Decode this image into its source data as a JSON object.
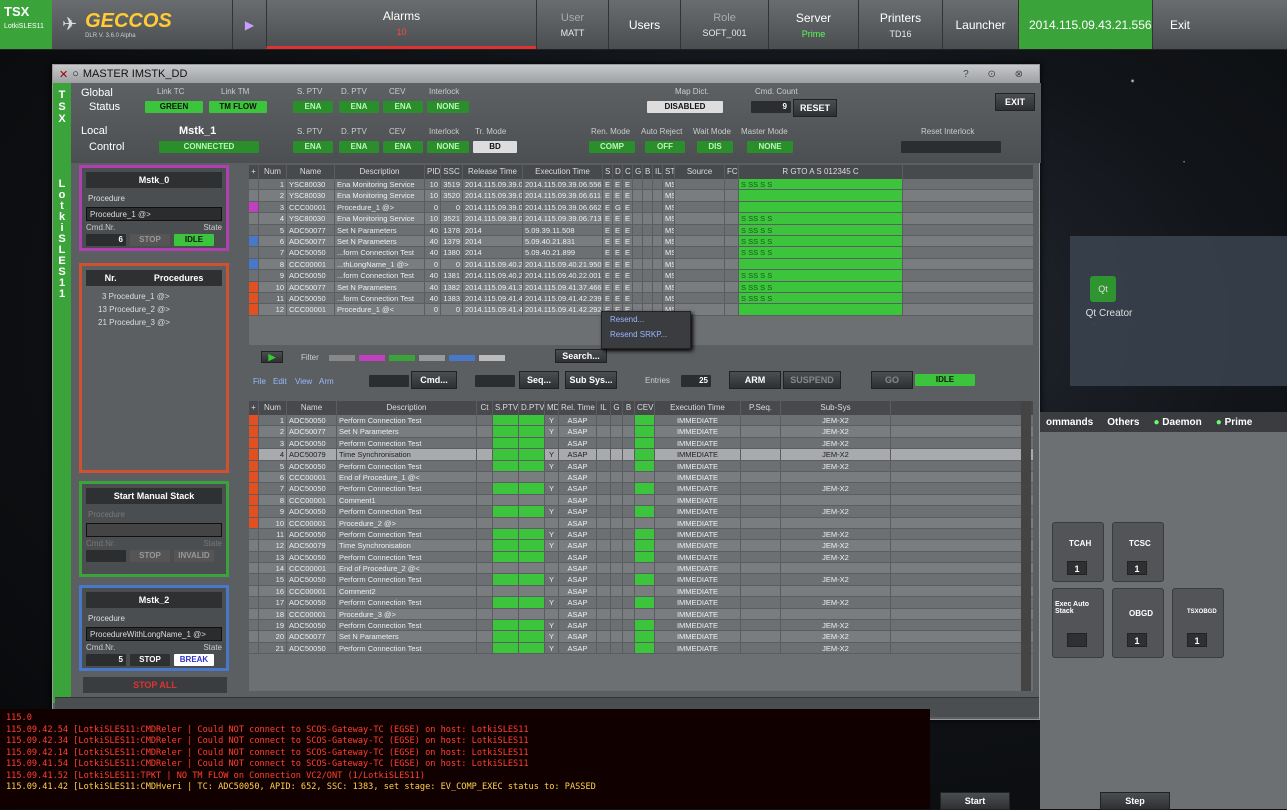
{
  "topbar": {
    "logo": "TSX",
    "host": "LotkiSLES11",
    "app_name": "GECCOS",
    "app_org": "DLR",
    "app_version": "V. 3.6.0 Alpha",
    "alarms_label": "Alarms",
    "alarms_count": "10",
    "user_label": "User",
    "user_value": "MATT",
    "users_label": "Users",
    "role_label": "Role",
    "role_value": "SOFT_001",
    "server_label": "Server",
    "server_value": "Prime",
    "printers_label": "Printers",
    "printers_value": "TD16",
    "launcher": "Launcher",
    "time": "2014.115.09.43.21.556",
    "exit": "Exit"
  },
  "window": {
    "title": "MASTER IMSTK_DD",
    "side_letters": [
      "T",
      "S",
      "X"
    ],
    "side_letters2": [
      "L",
      "o",
      "t",
      "k",
      "i",
      "S",
      "L",
      "E",
      "S",
      "1",
      "1"
    ],
    "global_label": "Global",
    "status_label": "Status",
    "local_label": "Local",
    "control_label": "Control",
    "mstk_name": "Mstk_1",
    "link_tc": "Link TC",
    "link_tc_val": "GREEN",
    "link_tm": "Link TM",
    "link_tm_val": "TM FLOW",
    "sptv": "S. PTV",
    "dptv": "D. PTV",
    "cev": "CEV",
    "interlock": "Interlock",
    "ena": "ENA",
    "none": "NONE",
    "map_dict": "Map Dict.",
    "map_dict_val": "DISABLED",
    "cmd_count": "Cmd. Count",
    "cmd_count_val": "9",
    "reset": "RESET",
    "exit": "EXIT",
    "connected": "CONNECTED",
    "tr_mode": "Tr. Mode",
    "tr_mode_val": "BD",
    "ren_mode": "Ren. Mode",
    "ren_mode_val": "COMP",
    "auto_reject": "Auto Reject",
    "auto_reject_val": "OFF",
    "wait_mode": "Wait Mode",
    "wait_mode_val": "DIS",
    "master_mode": "Master Mode",
    "master_mode_val": "NONE",
    "reset_interlock": "Reset Interlock"
  },
  "panels": {
    "p0": {
      "title": "Mstk_0",
      "proc_label": "Procedure",
      "proc_val": "Procedure_1 @>",
      "cmdnr": "Cmd.Nr.",
      "state": "State",
      "cmdnr_val": "6",
      "stop": "STOP",
      "state_val": "IDLE"
    },
    "procs": {
      "nr": "Nr.",
      "title": "Procedures",
      "items": [
        "3 Procedure_1 @>",
        "13 Procedure_2 @>",
        "21 Procedure_3 @>"
      ]
    },
    "manual": {
      "title": "Start Manual Stack",
      "proc_label": "Procedure",
      "cmdnr": "Cmd.Nr.",
      "state": "State",
      "stop": "STOP",
      "state_val": "INVALID"
    },
    "p2": {
      "title": "Mstk_2",
      "proc_label": "Procedure",
      "proc_val": "ProcedureWithLongName_1 @>",
      "cmdnr": "Cmd.Nr.",
      "state": "State",
      "cmdnr_val": "5",
      "stop": "STOP",
      "state_val": "BREAK",
      "stop_all": "STOP ALL"
    }
  },
  "table1": {
    "headers": [
      "+",
      "Num",
      "Name",
      "Description",
      "PID",
      "SSC",
      "Release Time",
      "Execution Time",
      "S",
      "D",
      "C",
      "G",
      "B",
      "IL",
      "ST",
      "Source",
      "FC",
      "R GTO A S 012345 C"
    ],
    "rows": [
      [
        "1",
        "YSC80030",
        "Ena Monitoring Service",
        "10",
        "3519",
        "2014.115.09.39.06",
        "2014.115.09.39.06.556",
        "E",
        "E",
        "E",
        "MS",
        "S SS  S              S"
      ],
      [
        "2",
        "YSC80030",
        "Ena Monitoring Service",
        "10",
        "3520",
        "2014.115.09.39.06",
        "2014.115.09.39.06.611",
        "E",
        "E",
        "E",
        "MS",
        ""
      ],
      [
        "3",
        "CCC00001",
        "Procedure_1 @>",
        "0",
        "0",
        "2014.115.09.39.06",
        "2014.115.09.39.06.662",
        "E",
        "G",
        "E",
        "MS",
        ""
      ],
      [
        "4",
        "YSC80030",
        "Ena Monitoring Service",
        "10",
        "3521",
        "2014.115.09.39.06",
        "2014.115.09.39.06.713",
        "E",
        "E",
        "E",
        "MS",
        "S SS  S              S"
      ],
      [
        "5",
        "ADC50077",
        "Set N Parameters",
        "40",
        "1378",
        "2014",
        "5.09.39.11.508",
        "E",
        "E",
        "E",
        "MS",
        "S SS  S              S"
      ],
      [
        "6",
        "ADC50077",
        "Set N Parameters",
        "40",
        "1379",
        "2014",
        "5.09.40.21.831",
        "E",
        "E",
        "E",
        "MS",
        "S SS  S              S"
      ],
      [
        "7",
        "ADC50050",
        "...form Connection Test",
        "40",
        "1380",
        "2014",
        "5.09.40.21.899",
        "E",
        "E",
        "E",
        "MS",
        "S SS  S              S"
      ],
      [
        "8",
        "CCC00001",
        "...thLongName_1 @>",
        "0",
        "0",
        "2014.115.09.40.21",
        "2014.115.09.40.21.950",
        "E",
        "E",
        "E",
        "MS",
        ""
      ],
      [
        "9",
        "ADC50050",
        "...form Connection Test",
        "40",
        "1381",
        "2014.115.09.40.22",
        "2014.115.09.40.22.001",
        "E",
        "E",
        "E",
        "MS",
        "S SS  S              S"
      ],
      [
        "10",
        "ADC50077",
        "Set N Parameters",
        "40",
        "1382",
        "2014.115.09.41.37",
        "2014.115.09.41.37.466",
        "E",
        "E",
        "E",
        "MS",
        "S SS  S              S"
      ],
      [
        "11",
        "ADC50050",
        "...form Connection Test",
        "40",
        "1383",
        "2014.115.09.41.42",
        "2014.115.09.41.42.239",
        "E",
        "E",
        "E",
        "MS",
        "S SS  S              S"
      ],
      [
        "12",
        "CCC00001",
        "Procedure_1 @<",
        "0",
        "0",
        "2014.115.09.41.42",
        "2014.115.09.41.42.292",
        "E",
        "E",
        "E",
        "MS",
        ""
      ]
    ]
  },
  "popup": {
    "resend": "Resend...",
    "resend_srkp": "Resend SRKP..."
  },
  "toolbar": {
    "filter": "Filter",
    "search": "Search...",
    "menu": [
      "File",
      "Edit",
      "View",
      "Arm"
    ],
    "cmd": "Cmd...",
    "seq": "Seq...",
    "subsys": "Sub Sys...",
    "entries": "Entries",
    "entries_val": "25",
    "arm": "ARM",
    "suspend": "SUSPEND",
    "go": "GO",
    "idle": "IDLE"
  },
  "table2": {
    "headers": [
      "+",
      "Num",
      "Name",
      "Description",
      "Ct",
      "S.PTV",
      "D.PTV",
      "MD",
      "Rel. Time",
      "IL",
      "G",
      "B",
      "CEV",
      "Execution Time",
      "P.Seq.",
      "Sub-Sys"
    ],
    "rows": [
      [
        "1",
        "ADC50050",
        "Perform Connection Test",
        "Y",
        "ASAP",
        "IMMEDIATE",
        "JEM-X2"
      ],
      [
        "2",
        "ADC50077",
        "Set N Parameters",
        "Y",
        "ASAP",
        "IMMEDIATE",
        "JEM-X2"
      ],
      [
        "3",
        "ADC50050",
        "Perform Connection Test",
        "",
        "ASAP",
        "IMMEDIATE",
        "JEM-X2"
      ],
      [
        "4",
        "ADC50079",
        "Time Synchronisation",
        "Y",
        "ASAP",
        "IMMEDIATE",
        "JEM-X2"
      ],
      [
        "5",
        "ADC50050",
        "Perform Connection Test",
        "Y",
        "ASAP",
        "IMMEDIATE",
        "JEM-X2"
      ],
      [
        "6",
        "CCC00001",
        "End of Procedure_1 @<",
        "",
        "ASAP",
        "IMMEDIATE",
        ""
      ],
      [
        "7",
        "ADC50050",
        "Perform Connection Test",
        "Y",
        "ASAP",
        "IMMEDIATE",
        "JEM-X2"
      ],
      [
        "8",
        "CCC00001",
        "Comment1",
        "",
        "ASAP",
        "IMMEDIATE",
        ""
      ],
      [
        "9",
        "ADC50050",
        "Perform Connection Test",
        "Y",
        "ASAP",
        "IMMEDIATE",
        "JEM-X2"
      ],
      [
        "10",
        "CCC00001",
        "Procedure_2 @>",
        "",
        "ASAP",
        "IMMEDIATE",
        ""
      ],
      [
        "11",
        "ADC50050",
        "Perform Connection Test",
        "Y",
        "ASAP",
        "IMMEDIATE",
        "JEM-X2"
      ],
      [
        "12",
        "ADC50079",
        "Time Synchronisation",
        "Y",
        "ASAP",
        "IMMEDIATE",
        "JEM-X2"
      ],
      [
        "13",
        "ADC50050",
        "Perform Connection Test",
        "",
        "ASAP",
        "IMMEDIATE",
        "JEM-X2"
      ],
      [
        "14",
        "CCC00001",
        "End of Procedure_2 @<",
        "",
        "ASAP",
        "IMMEDIATE",
        ""
      ],
      [
        "15",
        "ADC50050",
        "Perform Connection Test",
        "Y",
        "ASAP",
        "IMMEDIATE",
        "JEM-X2"
      ],
      [
        "16",
        "CCC00001",
        "Comment2",
        "",
        "ASAP",
        "IMMEDIATE",
        ""
      ],
      [
        "17",
        "ADC50050",
        "Perform Connection Test",
        "Y",
        "ASAP",
        "IMMEDIATE",
        "JEM-X2"
      ],
      [
        "18",
        "CCC00001",
        "Procedure_3 @>",
        "",
        "ASAP",
        "IMMEDIATE",
        ""
      ],
      [
        "19",
        "ADC50050",
        "Perform Connection Test",
        "Y",
        "ASAP",
        "IMMEDIATE",
        "JEM-X2"
      ],
      [
        "20",
        "ADC50077",
        "Set N Parameters",
        "Y",
        "ASAP",
        "IMMEDIATE",
        "JEM-X2"
      ],
      [
        "21",
        "ADC50050",
        "Perform Connection Test",
        "Y",
        "ASAP",
        "IMMEDIATE",
        "JEM-X2"
      ]
    ]
  },
  "right": {
    "tabs": [
      "ommands",
      "Others",
      "Daemon",
      "Prime"
    ],
    "qt": "Qt Creator",
    "tiles": [
      "TCAH",
      "TCSC",
      "Exec Auto Stack",
      "OBGD",
      "TSXOBGD"
    ],
    "tile_nums": [
      "1",
      "1",
      "1",
      "1"
    ],
    "start": "Start",
    "step": "Step"
  },
  "console": {
    "lines": [
      "115.0",
      "115.09.42.54 [LotkiSLES11:CMDReler   | Could NOT connect to SCOS-Gateway-TC (EGSE) on host: LotkiSLES11",
      "115.09.42.34 [LotkiSLES11:CMDReler   | Could NOT connect to SCOS-Gateway-TC (EGSE) on host: LotkiSLES11",
      "115.09.42.14 [LotkiSLES11:CMDReler   | Could NOT connect to SCOS-Gateway-TC (EGSE) on host: LotkiSLES11",
      "115.09.41.54 [LotkiSLES11:CMDReler   | Could NOT connect to SCOS-Gateway-TC (EGSE) on host: LotkiSLES11",
      "115.09.41.52 [LotkiSLES11:TPKT       | NO TM FLOW on Connection VC2/ONT (1/LotkiSLES11)",
      "115.09.41.42 [LotkiSLES11:CMDHveri   | TC: ADC50050, APID: 652, SSC: 1383, set stage: EV_COMP_EXEC status to: PASSED"
    ]
  },
  "colors": {
    "green": "#3cc43c",
    "red": "#e05020",
    "magenta": "#c040c0",
    "blue": "#4a78c8"
  }
}
